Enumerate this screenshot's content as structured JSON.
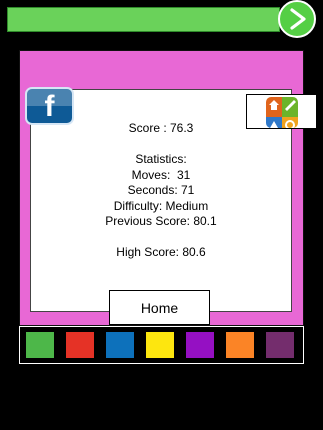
{
  "colors": {
    "top_bar": "#6ad25a",
    "play_button": "#55cf45",
    "panel": "#e868d5",
    "background": "#000000"
  },
  "icons": {
    "play": "play-icon",
    "facebook": "facebook-icon",
    "apps": "app-store-icon"
  },
  "results": {
    "score_line": "Score : 76.3",
    "statistics_heading": "Statistics:",
    "moves_line": "Moves:  31",
    "seconds_line": "Seconds: 71",
    "difficulty_line": "Difficulty: Medium",
    "previous_score_line": "Previous Score: 80.1",
    "high_score_line": "High Score: 80.6"
  },
  "facebook_letter": "f",
  "home_button": {
    "label": "Home"
  },
  "palette": {
    "swatches": [
      {
        "name": "green",
        "color": "#4db749"
      },
      {
        "name": "red",
        "color": "#e53226"
      },
      {
        "name": "blue",
        "color": "#0d71bb"
      },
      {
        "name": "yellow",
        "color": "#fde60f"
      },
      {
        "name": "purple",
        "color": "#9510c3"
      },
      {
        "name": "orange",
        "color": "#fb8426"
      },
      {
        "name": "plum",
        "color": "#742d6d"
      }
    ]
  }
}
